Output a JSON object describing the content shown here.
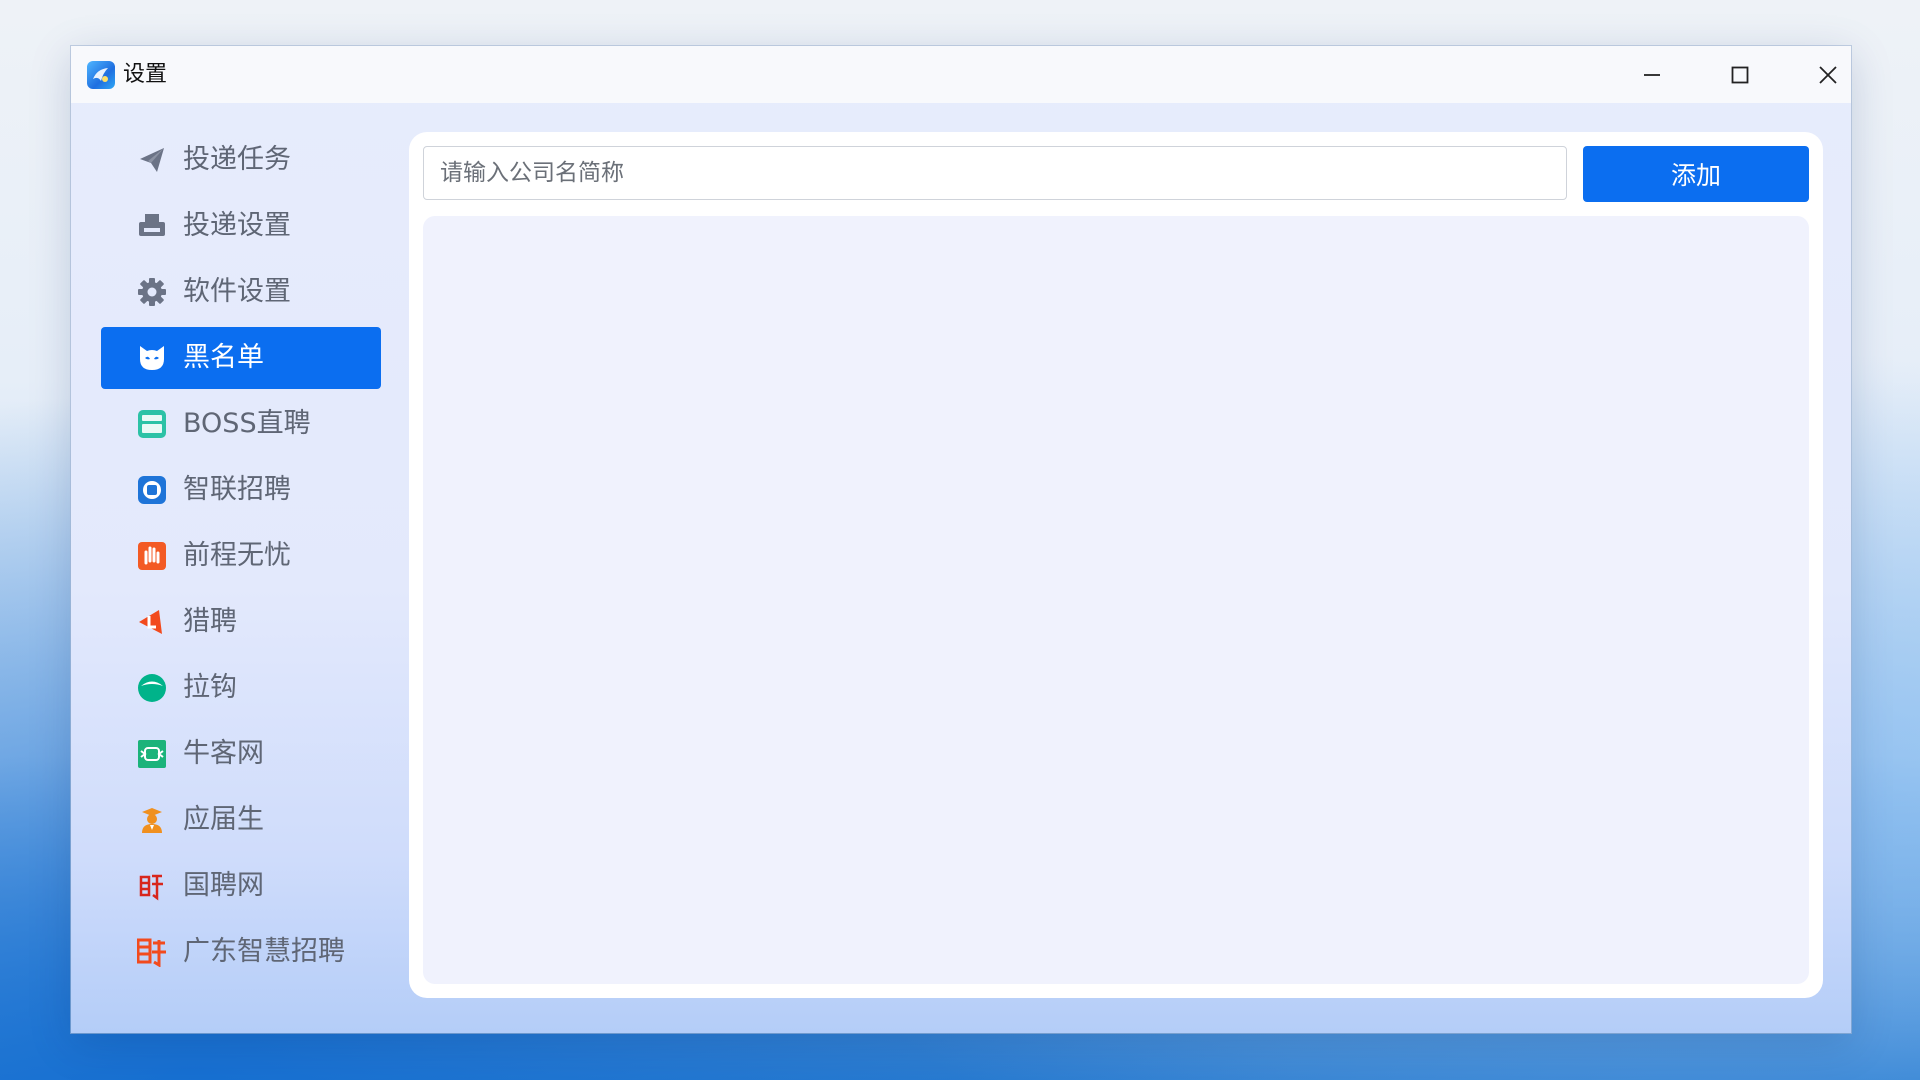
{
  "window": {
    "title": "设置",
    "controls": {
      "minimize_icon": "minimize-icon",
      "maximize_icon": "maximize-icon",
      "close_icon": "close-icon"
    }
  },
  "sidebar": {
    "active_index": 3,
    "items": [
      {
        "label": "投递任务",
        "icon": "paper-plane-icon"
      },
      {
        "label": "投递设置",
        "icon": "printer-icon"
      },
      {
        "label": "软件设置",
        "icon": "gear-icon"
      },
      {
        "label": "黑名单",
        "icon": "cat-mask-icon"
      },
      {
        "label": "BOSS直聘",
        "icon": "boss-zhipin-icon"
      },
      {
        "label": "智联招聘",
        "icon": "zhilian-icon"
      },
      {
        "label": "前程无忧",
        "icon": "qiancheng-icon"
      },
      {
        "label": "猎聘",
        "icon": "liepin-icon"
      },
      {
        "label": "拉钩",
        "icon": "lagou-icon"
      },
      {
        "label": "牛客网",
        "icon": "nowcoder-icon"
      },
      {
        "label": "应届生",
        "icon": "graduate-icon"
      },
      {
        "label": "国聘网",
        "icon": "guopin-icon"
      },
      {
        "label": "广东智慧招聘",
        "icon": "guangdong-pin-icon"
      }
    ]
  },
  "main": {
    "company_input": {
      "placeholder": "请输入公司名简称",
      "value": ""
    },
    "add_button_label": "添加"
  },
  "colors": {
    "accent": "#0b6ef0",
    "sidebar_text": "#5f6675",
    "list_background": "#f0f2fd"
  }
}
